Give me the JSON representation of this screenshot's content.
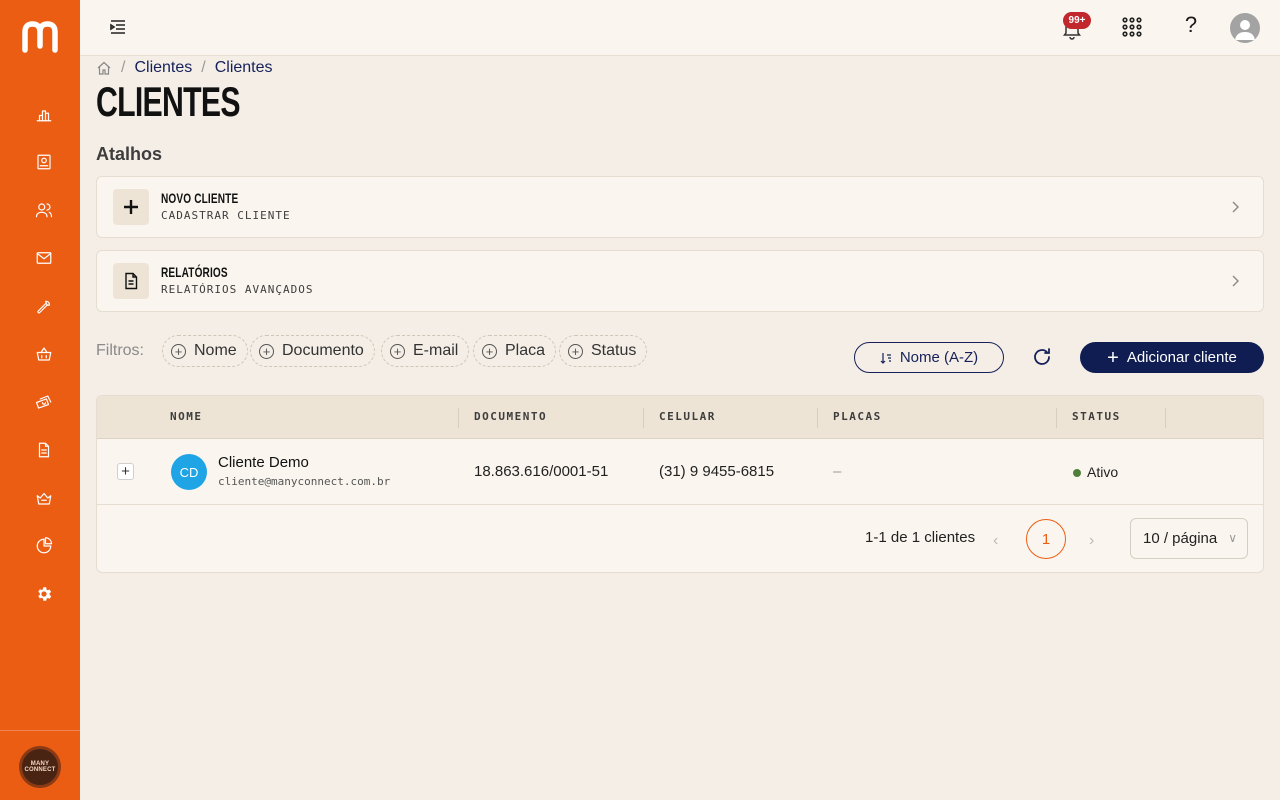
{
  "topbar": {
    "notification_count": "99+"
  },
  "breadcrumb": {
    "items": [
      "Clientes",
      "Clientes"
    ],
    "separator": "/"
  },
  "page": {
    "title": "CLIENTES",
    "shortcuts_title": "Atalhos"
  },
  "shortcuts": [
    {
      "title": "NOVO CLIENTE",
      "subtitle": "CADASTRAR CLIENTE",
      "icon": "plus-icon"
    },
    {
      "title": "RELATÓRIOS",
      "subtitle": "RELATÓRIOS AVANÇADOS",
      "icon": "document-icon"
    }
  ],
  "filters": {
    "label": "Filtros:",
    "chips": [
      "Nome",
      "Documento",
      "E-mail",
      "Placa",
      "Status"
    ]
  },
  "actions": {
    "sort_label": "Nome (A-Z)",
    "add_label": "Adicionar cliente"
  },
  "table": {
    "columns": [
      "NOME",
      "DOCUMENTO",
      "CELULAR",
      "PLACAS",
      "STATUS"
    ],
    "rows": [
      {
        "initials": "CD",
        "name": "Cliente Demo",
        "email": "cliente@manyconnect.com.br",
        "document": "18.863.616/0001-51",
        "phone": "(31) 9 9455-6815",
        "plates": "–",
        "status": "Ativo"
      }
    ]
  },
  "pagination": {
    "info": "1-1 de 1 clientes",
    "current_page": "1",
    "page_size": "10 / página",
    "prev": "‹",
    "next": "›"
  },
  "brand": {
    "avatar_text_line1": "MANY",
    "avatar_text_line2": "CONNECT"
  },
  "colors": {
    "accent": "#ec5d14",
    "navy": "#0f1d52",
    "avatar": "#1fa4e6",
    "status_active": "#4f7f3a",
    "badge": "#c1272d"
  }
}
